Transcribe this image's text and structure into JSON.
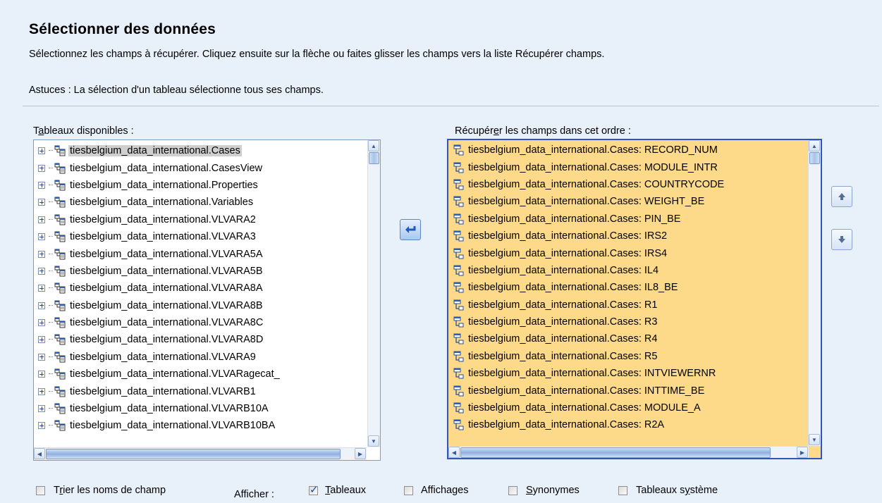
{
  "header": {
    "title": "Sélectionner des données",
    "description": "Sélectionnez les champs à récupérer. Cliquez ensuite sur la flèche ou faites glisser les champs vers la liste Récupérer champs.",
    "tips": "Astuces : La sélection d'un tableau sélectionne tous ses champs."
  },
  "available_tables": {
    "label_pre": "T",
    "label_underlined": "a",
    "label_post": "bleaux disponibles :",
    "items": [
      "tiesbelgium_data_international.Cases",
      "tiesbelgium_data_international.CasesView",
      "tiesbelgium_data_international.Properties",
      "tiesbelgium_data_international.Variables",
      "tiesbelgium_data_international.VLVARA2",
      "tiesbelgium_data_international.VLVARA3",
      "tiesbelgium_data_international.VLVARA5A",
      "tiesbelgium_data_international.VLVARA5B",
      "tiesbelgium_data_international.VLVARA8A",
      "tiesbelgium_data_international.VLVARA8B",
      "tiesbelgium_data_international.VLVARA8C",
      "tiesbelgium_data_international.VLVARA8D",
      "tiesbelgium_data_international.VLVARA9",
      "tiesbelgium_data_international.VLVARagecat_",
      "tiesbelgium_data_international.VLVARB1",
      "tiesbelgium_data_international.VLVARB10A",
      "tiesbelgium_data_international.VLVARB10BA"
    ]
  },
  "retrieve_fields": {
    "label_pre": "Récupér",
    "label_underlined": "e",
    "label_post": "r les champs dans cet ordre :",
    "items": [
      "tiesbelgium_data_international.Cases: RECORD_NUM",
      "tiesbelgium_data_international.Cases: MODULE_INTR",
      "tiesbelgium_data_international.Cases: COUNTRYCODE",
      "tiesbelgium_data_international.Cases: WEIGHT_BE",
      "tiesbelgium_data_international.Cases: PIN_BE",
      "tiesbelgium_data_international.Cases: IRS2",
      "tiesbelgium_data_international.Cases: IRS4",
      "tiesbelgium_data_international.Cases: IL4",
      "tiesbelgium_data_international.Cases: IL8_BE",
      "tiesbelgium_data_international.Cases: R1",
      "tiesbelgium_data_international.Cases: R3",
      "tiesbelgium_data_international.Cases: R4",
      "tiesbelgium_data_international.Cases: R5",
      "tiesbelgium_data_international.Cases: INTVIEWERNR",
      "tiesbelgium_data_international.Cases: INTTIME_BE",
      "tiesbelgium_data_international.Cases: MODULE_A",
      "tiesbelgium_data_international.Cases: R2A"
    ]
  },
  "options": {
    "sort_pre": "T",
    "sort_underlined": "r",
    "sort_post": "ier les noms de champ",
    "show_label": "Afficher :",
    "tables_underlined": "T",
    "tables_post": "ableaux",
    "views_label": "Affichages",
    "synonyms_underlined": "S",
    "synonyms_post": "ynonymes",
    "system_pre": "Tableaux s",
    "system_underlined": "y",
    "system_post": "stème"
  },
  "states": {
    "sort_checked": false,
    "tables_checked": true,
    "views_checked": false,
    "synonyms_checked": false,
    "system_checked": false
  },
  "colors": {
    "background": "#e8f0fa",
    "selected_list": "#fdd98a",
    "focus_border": "#2f56b8"
  }
}
